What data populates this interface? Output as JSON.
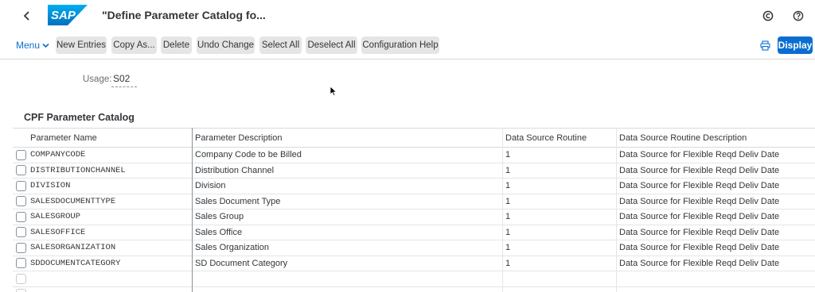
{
  "shell": {
    "title": "\"Define Parameter Catalog fo...",
    "logo_text": "SAP",
    "brand_color": "#0a6ed1",
    "icons": [
      "back-icon",
      "copyright-icon",
      "help-icon"
    ]
  },
  "toolbar": {
    "menu_label": "Menu",
    "buttons": [
      "New Entries",
      "Copy As...",
      "Delete",
      "Undo Change",
      "Select All",
      "Deselect All",
      "Configuration Help"
    ],
    "display_label": "Display",
    "icons": [
      "chevron-down-icon",
      "print-icon"
    ]
  },
  "usage": {
    "label": "Usage:",
    "value": "S02"
  },
  "table": {
    "title": "CPF Parameter Catalog",
    "columns": [
      "Parameter Name",
      "Parameter Description",
      "Data Source Routine",
      "Data Source Routine Description"
    ],
    "rows": [
      [
        "COMPANYCODE",
        "Company Code to be Billed",
        "1",
        "Data Source for Flexible Reqd Deliv Date"
      ],
      [
        "DISTRIBUTIONCHANNEL",
        "Distribution Channel",
        "1",
        "Data Source for Flexible Reqd Deliv Date"
      ],
      [
        "DIVISION",
        "Division",
        "1",
        "Data Source for Flexible Reqd Deliv Date"
      ],
      [
        "SALESDOCUMENTTYPE",
        "Sales Document Type",
        "1",
        "Data Source for Flexible Reqd Deliv Date"
      ],
      [
        "SALESGROUP",
        "Sales Group",
        "1",
        "Data Source for Flexible Reqd Deliv Date"
      ],
      [
        "SALESOFFICE",
        "Sales Office",
        "1",
        "Data Source for Flexible Reqd Deliv Date"
      ],
      [
        "SALESORGANIZATION",
        "Sales Organization",
        "1",
        "Data Source for Flexible Reqd Deliv Date"
      ],
      [
        "SDDOCUMENTCATEGORY",
        "SD Document Category",
        "1",
        "Data Source for Flexible Reqd Deliv Date"
      ]
    ]
  }
}
